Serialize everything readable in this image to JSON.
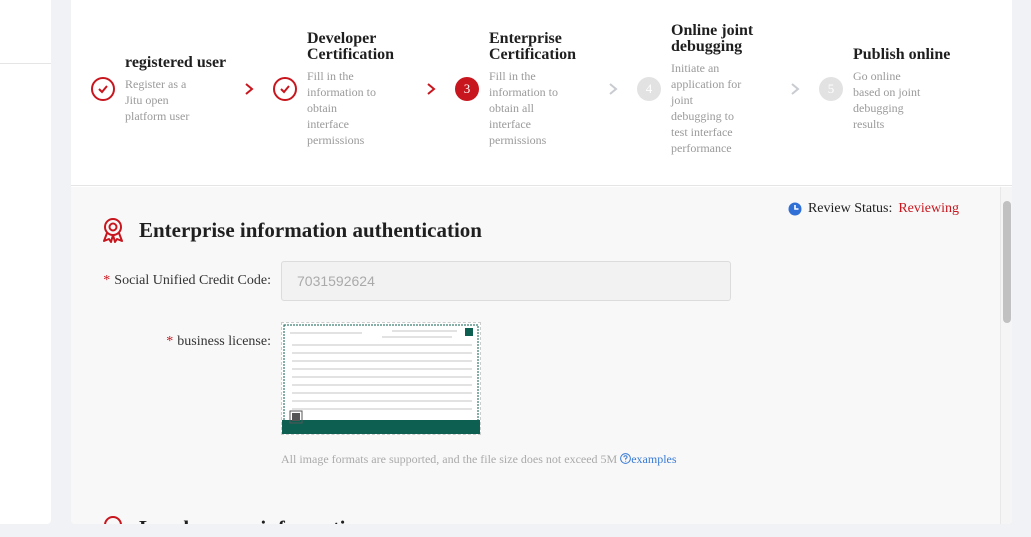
{
  "steps": [
    {
      "title": "registered user",
      "desc": "Register as a\nJitu open\nplatform user",
      "state": "done",
      "number": "1"
    },
    {
      "title": "Developer\nCertification",
      "desc": "Fill in the\ninformation to\nobtain\ninterface\npermissions",
      "state": "done",
      "number": "2"
    },
    {
      "title": "Enterprise\nCertification",
      "desc": "Fill in the\ninformation to\nobtain all\ninterface\npermissions",
      "state": "active",
      "number": "3"
    },
    {
      "title": "Online joint\ndebugging",
      "desc": "Initiate an\napplication for\njoint\ndebugging to\ntest interface\nperformance",
      "state": "wait",
      "number": "4"
    },
    {
      "title": "Publish online",
      "desc": "Go online\nbased on joint\ndebugging\nresults",
      "state": "wait",
      "number": "5"
    }
  ],
  "review": {
    "label": "Review Status:",
    "status": "Reviewing",
    "icon": "clock-icon"
  },
  "section": {
    "title": "Enterprise information authentication",
    "icon": "award-ribbon-icon"
  },
  "form": {
    "credit_code_label": "Social Unified Credit Code:",
    "credit_code_value": "7031592624",
    "license_label": "business license:",
    "required_mark": "*"
  },
  "hint": {
    "text": "All image formats are supported, and the file size does not exceed 5M",
    "link": "examples"
  },
  "section2": {
    "title": "Legal person information"
  },
  "colors": {
    "accent": "#c8161e",
    "link": "#3a7bd5",
    "clock": "#2f6fd6"
  }
}
